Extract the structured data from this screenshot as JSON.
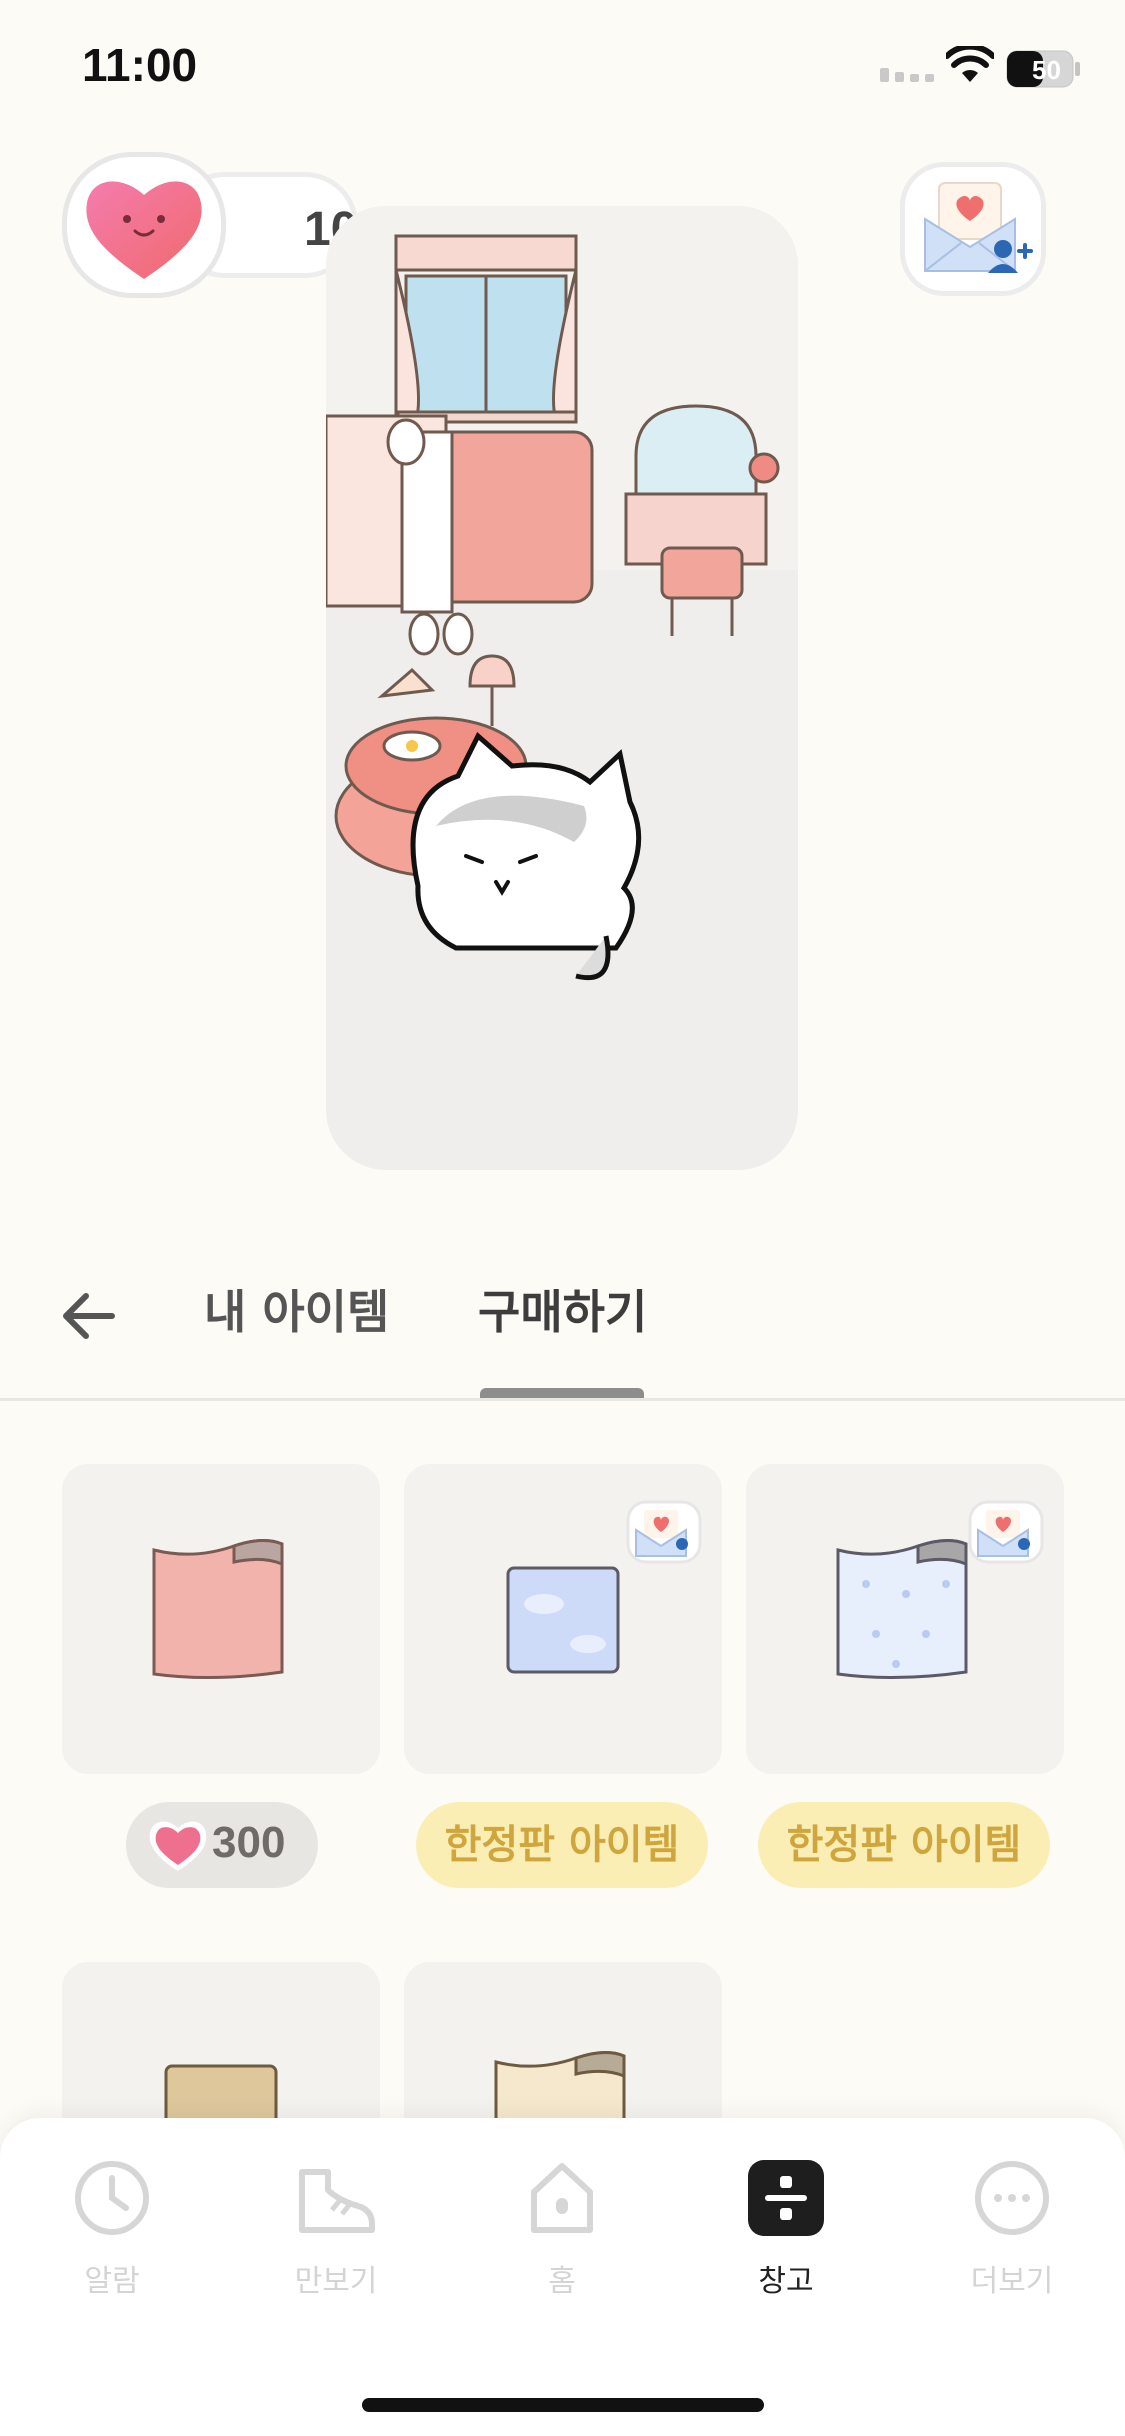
{
  "status": {
    "time": "11:00",
    "battery": "50"
  },
  "hearts": {
    "count": "10"
  },
  "tabs": {
    "my_items": "내 아이템",
    "buy": "구매하기",
    "active": "buy"
  },
  "items": [
    {
      "kind": "price",
      "price": "300",
      "color": "#f0b6b2"
    },
    {
      "kind": "limited",
      "label": "한정판 아이템",
      "color": "#c9d7f6"
    },
    {
      "kind": "limited",
      "label": "한정판 아이템",
      "color": "#e7eefc"
    },
    {
      "kind": "none",
      "color": "#dec79b"
    },
    {
      "kind": "none",
      "color": "#f5e8cd"
    }
  ],
  "nav": [
    {
      "label": "알람",
      "icon": "clock-icon"
    },
    {
      "label": "만보기",
      "icon": "shoe-icon"
    },
    {
      "label": "홈",
      "icon": "house-icon"
    },
    {
      "label": "창고",
      "icon": "storage-icon",
      "active": true
    },
    {
      "label": "더보기",
      "icon": "more-icon"
    }
  ],
  "colors": {
    "accent_heart": "#ef6f8f",
    "limited_bg": "#fbeeb5",
    "limited_text": "#cfa53d",
    "background": "#fcfbf6"
  }
}
